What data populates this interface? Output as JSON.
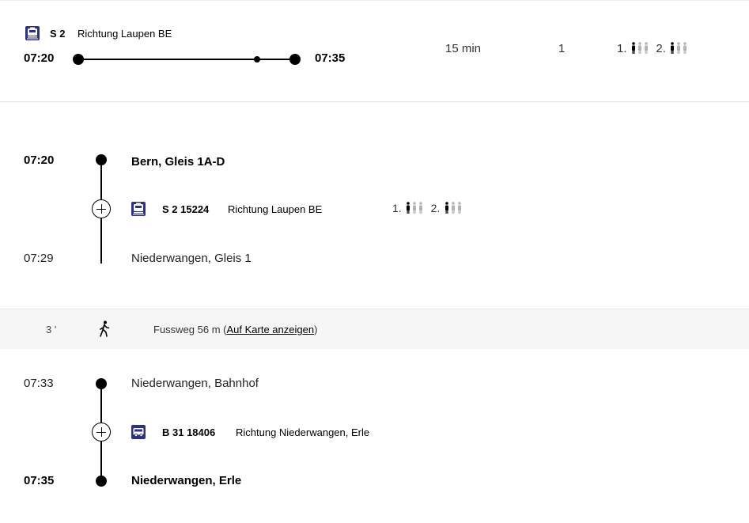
{
  "summary": {
    "line": "S 2",
    "direction": "Richtung Laupen BE",
    "dep_time": "07:20",
    "arr_time": "07:35",
    "duration": "15 min",
    "changes": "1",
    "class1_label": "1.",
    "class2_label": "2.",
    "class1_occupancy_level": 1,
    "class2_occupancy_level": 1,
    "occupancy_scale_max": 3
  },
  "leg1": {
    "from_time": "07:20",
    "from_stop": "Bern, Gleis 1A-D",
    "line": "S 2 15224",
    "direction": "Richtung Laupen BE",
    "class1_label": "1.",
    "class2_label": "2.",
    "to_time": "07:29",
    "to_stop": "Niederwangen, Gleis 1",
    "icon": "train-icon"
  },
  "walk": {
    "minutes": "3 '",
    "text": "Fussweg 56 m (",
    "link": "Auf Karte anzeigen",
    "text_end": ")",
    "icon": "walk-icon"
  },
  "leg2": {
    "from_time": "07:33",
    "from_stop": "Niederwangen, Bahnhof",
    "line": "B 31 18406",
    "direction": "Richtung Niederwangen, Erle",
    "to_time": "07:35",
    "to_stop": "Niederwangen, Erle",
    "icon": "bus-icon"
  },
  "colors": {
    "sbb_blue": "#2d327d",
    "occupancy_inactive": "#b3b3b3",
    "walk_band": "#f6f6f6"
  }
}
